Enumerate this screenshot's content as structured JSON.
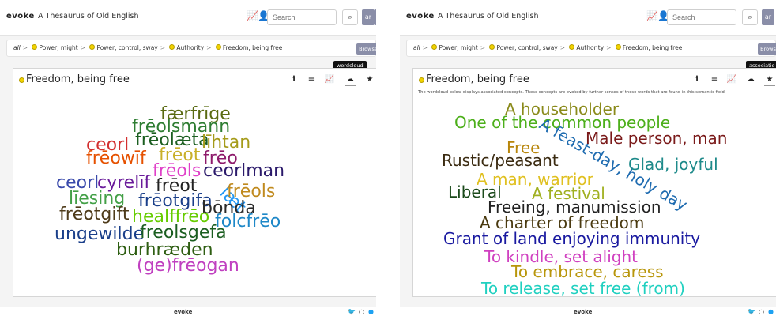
{
  "colors": {
    "accent": "#8a8ea8",
    "dot": "#f2d300",
    "link": "#1da1f2"
  },
  "left": {
    "logo": "evoke",
    "app_title": "A Thesaurus of Old English",
    "search_placeholder": "Search",
    "user_btn_1": "ar",
    "user_btn_2": "b",
    "breadcrumb": [
      "all",
      "Power, might",
      "Power, control, sway",
      "Authority",
      "Freedom, being free"
    ],
    "browse_label": "Browse",
    "tooltip": "wordcloud",
    "card_title": "Freedom, being free",
    "footer_logo": "evoke",
    "wordcloud": [
      {
        "text": "færfrīge",
        "color": "#5a6b12"
      },
      {
        "text": "frēolsmann",
        "color": "#2e7d32"
      },
      {
        "text": "ceorl",
        "color": "#d32f2f"
      },
      {
        "text": "frēolæta",
        "color": "#1b5e20"
      },
      {
        "text": "līhtan",
        "color": "#a59b1a"
      },
      {
        "text": "frēowīf",
        "color": "#e65100"
      },
      {
        "text": "frēot",
        "color": "#c9b02a"
      },
      {
        "text": "frēo",
        "color": "#8e1a6b"
      },
      {
        "text": "frēols",
        "color": "#e040c8"
      },
      {
        "text": "ceorlman",
        "color": "#2b1a6b"
      },
      {
        "text": "ceorl",
        "color": "#3949ab"
      },
      {
        "text": "cyrelīf",
        "color": "#6a1b9a"
      },
      {
        "text": "frēot",
        "color": "#222222"
      },
      {
        "text": "læt",
        "color": "#2196f3"
      },
      {
        "text": "frēols",
        "color": "#c08a1e"
      },
      {
        "text": "līesing",
        "color": "#43a047"
      },
      {
        "text": "frēotgifa",
        "color": "#1a3f8a"
      },
      {
        "text": "bōnda",
        "color": "#2a2a2a"
      },
      {
        "text": "frēotgift",
        "color": "#4e3b1a"
      },
      {
        "text": "healffrēo",
        "color": "#66cc00"
      },
      {
        "text": "folcfrēo",
        "color": "#1e88c8"
      },
      {
        "text": "ungewilde",
        "color": "#1a3f8a"
      },
      {
        "text": "freolsgefa",
        "color": "#1b5e20"
      },
      {
        "text": "burhræden",
        "color": "#2e5e12"
      },
      {
        "text": "(ge)frēogan",
        "color": "#c040c0"
      }
    ]
  },
  "right": {
    "logo": "evoke",
    "app_title": "A Thesaurus of Old English",
    "search_placeholder": "Search",
    "user_btn_1": "ar",
    "breadcrumb": [
      "all",
      "Power, might",
      "Power, control, sway",
      "Authority",
      "Freedom, being free"
    ],
    "browse_label": "Browse",
    "tooltip": "associatio",
    "card_title": "Freedom, being free",
    "description": "The wordcloud below displays associated concepts. These concepts are evoked by further senses of those words that are found in this semantic field.",
    "footer_logo": "evoke",
    "wordcloud": [
      {
        "text": "A householder",
        "color": "#8a8a1a"
      },
      {
        "text": "One of the common people",
        "color": "#4caf1a"
      },
      {
        "text": "A feast-day, holy day",
        "color": "#1e6bb0"
      },
      {
        "text": "Free",
        "color": "#b8860b"
      },
      {
        "text": "Male person, man",
        "color": "#7a1a1a"
      },
      {
        "text": "Rustic/peasant",
        "color": "#3a2a10"
      },
      {
        "text": "Glad, joyful",
        "color": "#1e8a8a"
      },
      {
        "text": "A man, warrior",
        "color": "#e0c020"
      },
      {
        "text": "Liberal",
        "color": "#1b4a1b"
      },
      {
        "text": "A festival",
        "color": "#a0b020"
      },
      {
        "text": "Freeing, manumission",
        "color": "#222222"
      },
      {
        "text": "A charter of freedom",
        "color": "#4a3a10"
      },
      {
        "text": "Grant of land enjoying immunity",
        "color": "#1a1aa0"
      },
      {
        "text": "To kindle, set alight",
        "color": "#d040c0"
      },
      {
        "text": "To embrace, caress",
        "color": "#b8960b"
      },
      {
        "text": "To release, set free (from)",
        "color": "#20d0c0"
      }
    ]
  }
}
